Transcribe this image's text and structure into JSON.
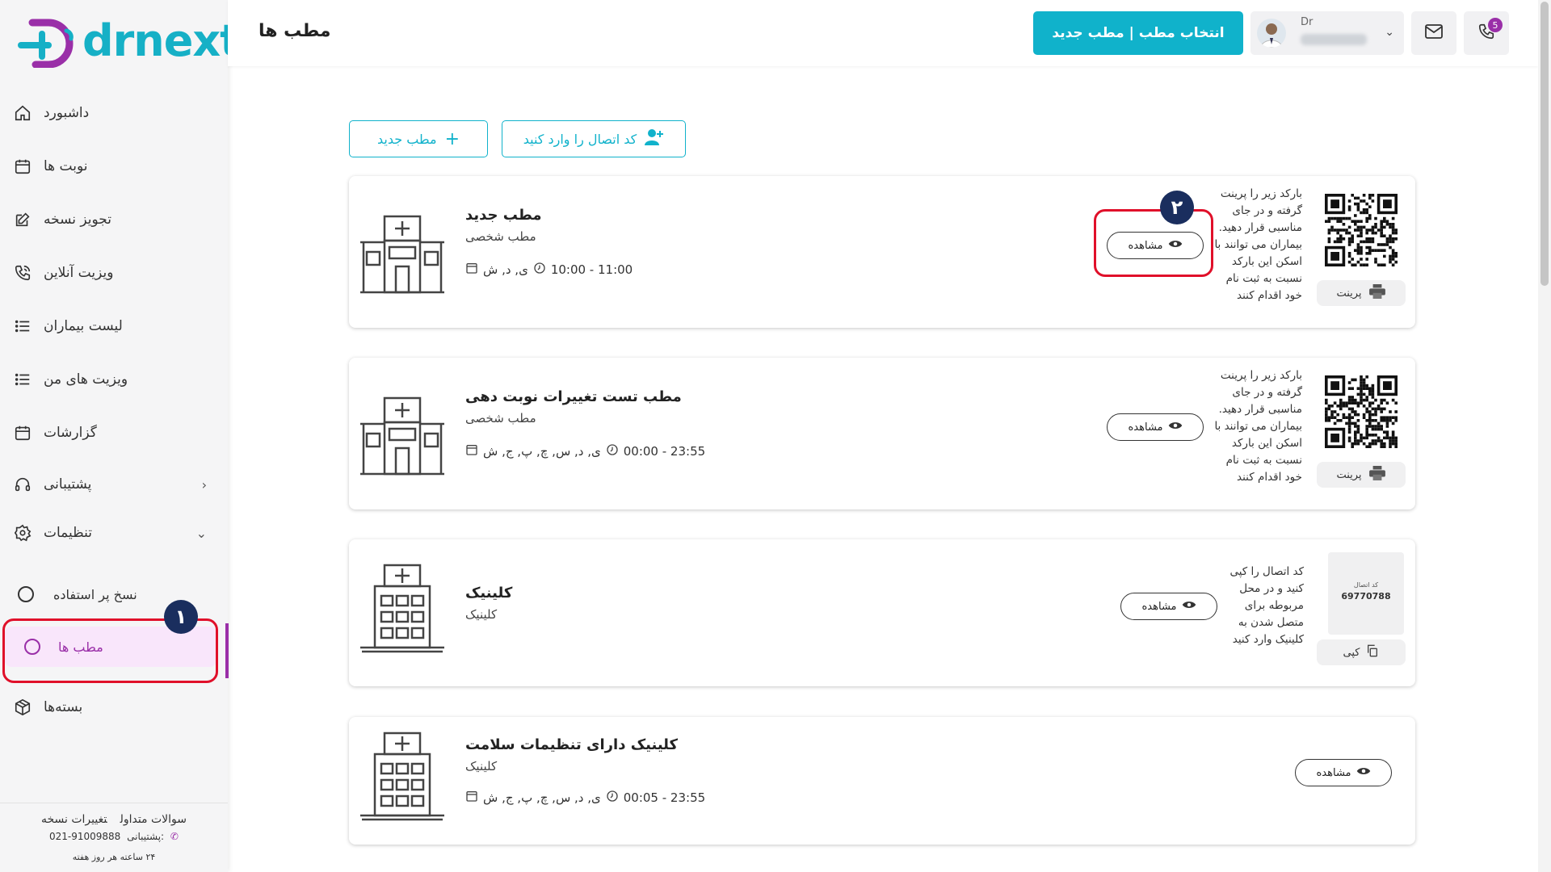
{
  "brand": {
    "name": "drnext",
    "color": "#16b0c6",
    "accent": "#9a2fa8"
  },
  "sidebar": {
    "items": [
      {
        "label": "داشبورد",
        "icon": "home-icon"
      },
      {
        "label": "نوبت ها",
        "icon": "calendar-icon"
      },
      {
        "label": "تجویز نسخه",
        "icon": "edit-icon"
      },
      {
        "label": "ویزیت آنلاین",
        "icon": "phone-call-icon"
      },
      {
        "label": "لیست بیماران",
        "icon": "list-icon"
      },
      {
        "label": "ویزیت های من",
        "icon": "list-icon"
      },
      {
        "label": "گزارشات",
        "icon": "calendar-icon"
      },
      {
        "label": "پشتیبانی",
        "icon": "headset-icon"
      },
      {
        "label": "تنظیمات",
        "icon": "gear-icon"
      }
    ],
    "sub_items": [
      {
        "label": "نسخ پر استفاده"
      },
      {
        "label": "مطب ها",
        "active": true
      }
    ],
    "packages": {
      "label": "بسته‌ها",
      "icon": "box-icon"
    },
    "footer": {
      "faq": "سوالات متداول",
      "changelog": "تغییرات نسخه",
      "support_label": "پشتیبانی:",
      "support_phone": "021-91009888",
      "hours": "۲۴ ساعته هر روز هفته"
    },
    "markers": {
      "one": "۱",
      "two": "۲"
    }
  },
  "header": {
    "title": "مطب ها",
    "primary_button": "انتخاب مطب | مطب جدید",
    "user_prefix": "Dr",
    "notif_count": "5"
  },
  "actions": {
    "enter_code": "کد اتصال را وارد کنید",
    "new_office": "مطب جدید"
  },
  "cards": [
    {
      "title": "مطب جدید",
      "type": "مطب شخصی",
      "time": "10:00 - 11:00",
      "days": "ی, د, ش",
      "view": "مشاهده",
      "qr_text": "بارکد زیر را پرینت گرفته و در جای مناسبی قرار دهید. بیماران می توانند با اسکن این بارکد نسبت به ثبت نام خود اقدام کنند",
      "print": "پرینت"
    },
    {
      "title": "مطب تست تغییرات نوبت دهی",
      "type": "مطب شخصی",
      "time": "00:00 - 23:55",
      "days": "ی, د, س, چ, پ, ج, ش",
      "view": "مشاهده",
      "qr_text": "بارکد زیر را پرینت گرفته و در جای مناسبی قرار دهید. بیماران می توانند با اسکن این بارکد نسبت به ثبت نام خود اقدام کنند",
      "print": "پرینت"
    },
    {
      "title": "کلینیک",
      "type": "کلینیک",
      "view": "مشاهده",
      "code_text": "کد اتصال را کپی کنید و در محل مربوطه برای متصل شدن به کلینیک وارد کنید",
      "code_label": "کد اتصال",
      "code_value": "69770788",
      "copy": "کپی"
    },
    {
      "title": "کلینیک دارای تنظیمات سلامت",
      "type": "کلینیک",
      "time": "00:05 - 23:55",
      "days": "ی, د, س, چ, پ, ج, ش",
      "view": "مشاهده"
    }
  ]
}
